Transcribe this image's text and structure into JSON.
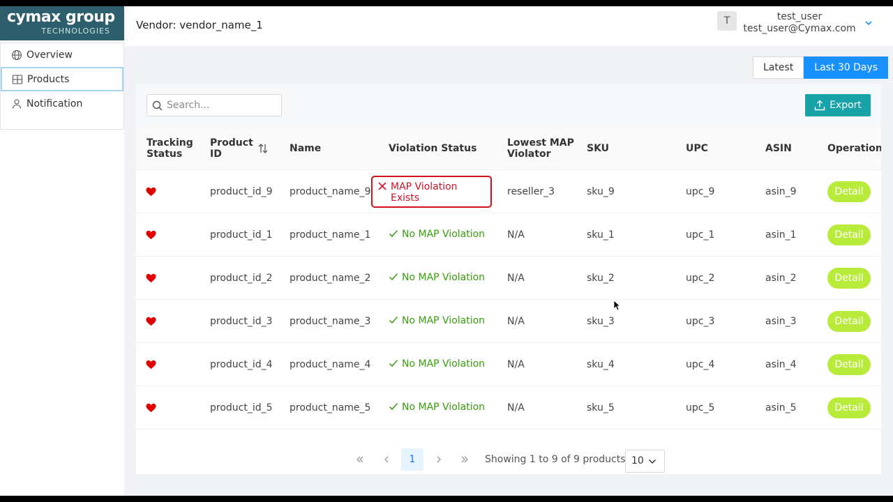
{
  "sidebar": {
    "logo_main": "cymax group",
    "logo_sub": "TECHNOLOGIES",
    "items": [
      {
        "label": "Overview",
        "icon": "globe-icon"
      },
      {
        "label": "Products",
        "icon": "grid-icon",
        "active": true
      },
      {
        "label": "Notification",
        "icon": "user-icon"
      }
    ]
  },
  "header": {
    "vendor": "Vendor: vendor_name_1",
    "avatar_initial": "T",
    "user_name": "test_user",
    "user_email": "test_user@Cymax.com"
  },
  "range": {
    "latest": "Latest",
    "last30": "Last 30 Days",
    "active": "Last 30 Days"
  },
  "toolbar": {
    "search_placeholder": "Search...",
    "export_label": "Export"
  },
  "table": {
    "columns": [
      "Tracking Status",
      "Product ID",
      "Name",
      "Violation Status",
      "Lowest MAP Violator",
      "SKU",
      "UPC",
      "ASIN",
      "Operation"
    ],
    "col_product_id": [
      "Product",
      "ID"
    ],
    "col_tracking": [
      "Tracking",
      "Status"
    ],
    "col_lowest": [
      "Lowest MAP",
      "Violator"
    ],
    "rows": [
      {
        "product_id": "product_id_9",
        "name": "product_name_9",
        "violation": [
          "MAP Violation",
          "Exists"
        ],
        "violator": "reseller_3",
        "sku": "sku_9",
        "upc": "upc_9",
        "asin": "asin_9",
        "op": "Detail"
      },
      {
        "product_id": "product_id_1",
        "name": "product_name_1",
        "violation": "No MAP Violation",
        "violator": "N/A",
        "sku": "sku_1",
        "upc": "upc_1",
        "asin": "asin_1",
        "op": "Detail"
      },
      {
        "product_id": "product_id_2",
        "name": "product_name_2",
        "violation": "No MAP Violation",
        "violator": "N/A",
        "sku": "sku_2",
        "upc": "upc_2",
        "asin": "asin_2",
        "op": "Detail"
      },
      {
        "product_id": "product_id_3",
        "name": "product_name_3",
        "violation": "No MAP Violation",
        "violator": "N/A",
        "sku": "sku_3",
        "upc": "upc_3",
        "asin": "asin_3",
        "op": "Detail"
      },
      {
        "product_id": "product_id_4",
        "name": "product_name_4",
        "violation": "No MAP Violation",
        "violator": "N/A",
        "sku": "sku_4",
        "upc": "upc_4",
        "asin": "asin_4",
        "op": "Detail"
      },
      {
        "product_id": "product_id_5",
        "name": "product_name_5",
        "violation": "No MAP Violation",
        "violator": "N/A",
        "sku": "sku_5",
        "upc": "upc_5",
        "asin": "asin_5",
        "op": "Detail"
      }
    ]
  },
  "pagination": {
    "current_page": "1",
    "showing": "Showing 1 to 9 of 9 products",
    "page_size": "10"
  },
  "colors": {
    "logo_bg": "#2d5e6b",
    "primary": "#1890ff",
    "export": "#17a2a8",
    "detail": "#b9ec3a",
    "ok": "#389e0d",
    "violation": "#cf1322",
    "heart": "#e00000"
  }
}
